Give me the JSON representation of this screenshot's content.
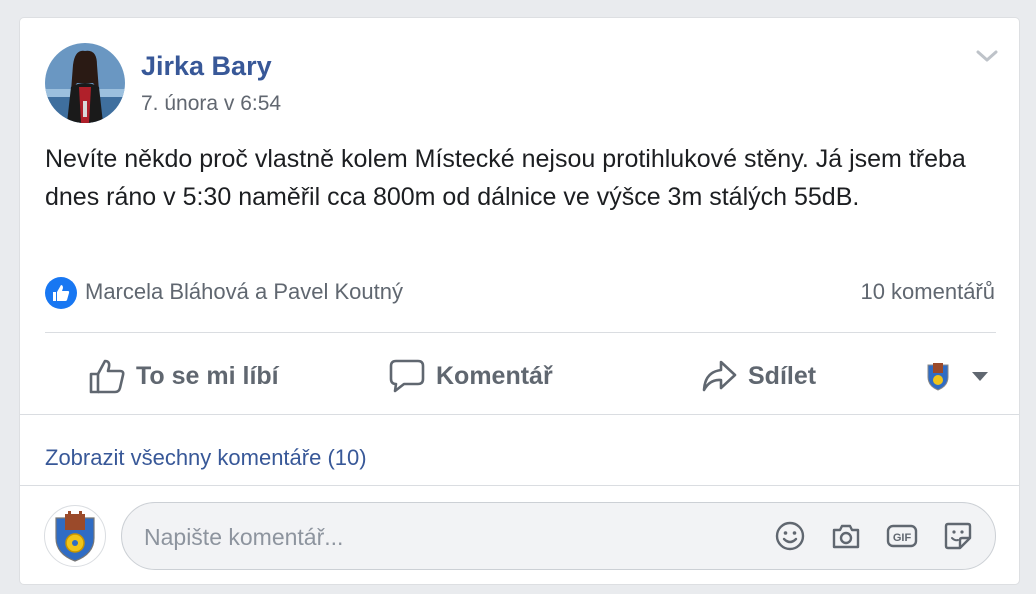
{
  "post": {
    "author": "Jirka Bary",
    "timestamp": "7. února v 6:54",
    "text": "Nevíte někdo proč vlastně kolem Místecké nejsou protihlukové stěny. Já jsem třeba dnes ráno v 5:30 naměřil cca 800m od dálnice ve výšce 3m stálých 55dB.",
    "reactors": "Marcela Bláhová a Pavel Koutný",
    "comments_count": "10 komentářů"
  },
  "actions": {
    "like": "To se mi líbí",
    "comment": "Komentář",
    "share": "Sdílet"
  },
  "comments": {
    "view_all": "Zobrazit všechny komentáře (10)",
    "placeholder": "Napište komentář..."
  },
  "icons": {
    "like_badge": "thumbs-up-icon",
    "chevron": "chevron-down-icon",
    "emoji": "smiley-icon",
    "camera": "camera-icon",
    "gif": "gif-icon",
    "sticker": "sticker-icon"
  },
  "colors": {
    "link": "#385898",
    "like_blue": "#1877f2",
    "muted": "#606770",
    "background": "#e9ebee"
  }
}
